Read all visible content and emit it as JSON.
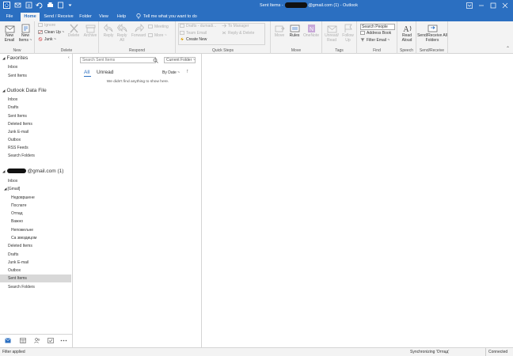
{
  "window": {
    "title_prefix": "Sent Items - ",
    "title_suffix": "@gmail.com (1)  -  Outlook"
  },
  "tabs": [
    {
      "label": "File"
    },
    {
      "label": "Home"
    },
    {
      "label": "Send / Receive"
    },
    {
      "label": "Folder"
    },
    {
      "label": "View"
    },
    {
      "label": "Help"
    }
  ],
  "tell_me": "Tell me what you want to do",
  "ribbon": {
    "new": {
      "label": "New",
      "new_email": "New Email",
      "new_items": "New Items ~"
    },
    "delete": {
      "label": "Delete",
      "ignore": "Ignore",
      "clean_up": "Clean Up ~",
      "junk": "Junk ~",
      "delete": "Delete",
      "archive": "Archive"
    },
    "respond": {
      "label": "Respond",
      "reply": "Reply",
      "reply_all": "Reply All",
      "forward": "Forward",
      "meeting": "Meeting",
      "more": "More ~"
    },
    "quick_steps": {
      "label": "Quick Steps",
      "drafts": "Drafts - dumadi...",
      "to_manager": "To Manager",
      "team_email": "Team Email",
      "reply_delete": "Reply & Delete",
      "create_new": "Create New"
    },
    "move": {
      "label": "Move",
      "move": "Move",
      "rules": "Rules",
      "onenote": "OneNote"
    },
    "tags": {
      "label": "Tags",
      "unread_read": "Unread/ Read",
      "follow_up": "Follow Up"
    },
    "find": {
      "label": "Find",
      "search_people": "Search People",
      "address_book": "Address Book",
      "filter_email": "Filter Email ~"
    },
    "speech": {
      "label": "Speech",
      "read_aloud": "Read Aloud"
    },
    "send_receive": {
      "label": "Send/Receive",
      "all_folders": "Send/Receive All Folders"
    }
  },
  "nav": {
    "favorites": {
      "header": "Favorites",
      "items": [
        "Inbox",
        "Sent Items"
      ]
    },
    "data_file": {
      "header": "Outlook Data File",
      "items": [
        "Inbox",
        "Drafts",
        "Sent Items",
        "Deleted Items",
        "Junk E-mail",
        "Outbox",
        "RSS Feeds",
        "Search Folders"
      ]
    },
    "account": {
      "header_suffix": "@gmail.com  (1)",
      "inbox": "Inbox",
      "gmail": "[Gmail]",
      "gmail_items": [
        "Недовршене",
        "Послате",
        "Отпад",
        "Важно",
        "Непожељне",
        "Са звездицом"
      ],
      "items": [
        "Deleted Items",
        "Drafts",
        "Junk E-mail",
        "Outbox",
        "Sent Items",
        "Search Folders"
      ]
    }
  },
  "msglist": {
    "search_placeholder": "Search Sent Items",
    "scope": "Current Folder  ~",
    "filter_all": "All",
    "filter_unread": "Unread",
    "sort": "By Date  ~",
    "sort_dir": "↑",
    "empty": "We didn't find anything to show here."
  },
  "status": {
    "left": "Filter applied",
    "sync": "Synchronizing  'Отпад'",
    "connected": "Connected"
  },
  "colors": {
    "accent": "#2b6fc1",
    "ribbon_bg": "#f3f3f3",
    "selected_bg": "#d8d8d8"
  }
}
